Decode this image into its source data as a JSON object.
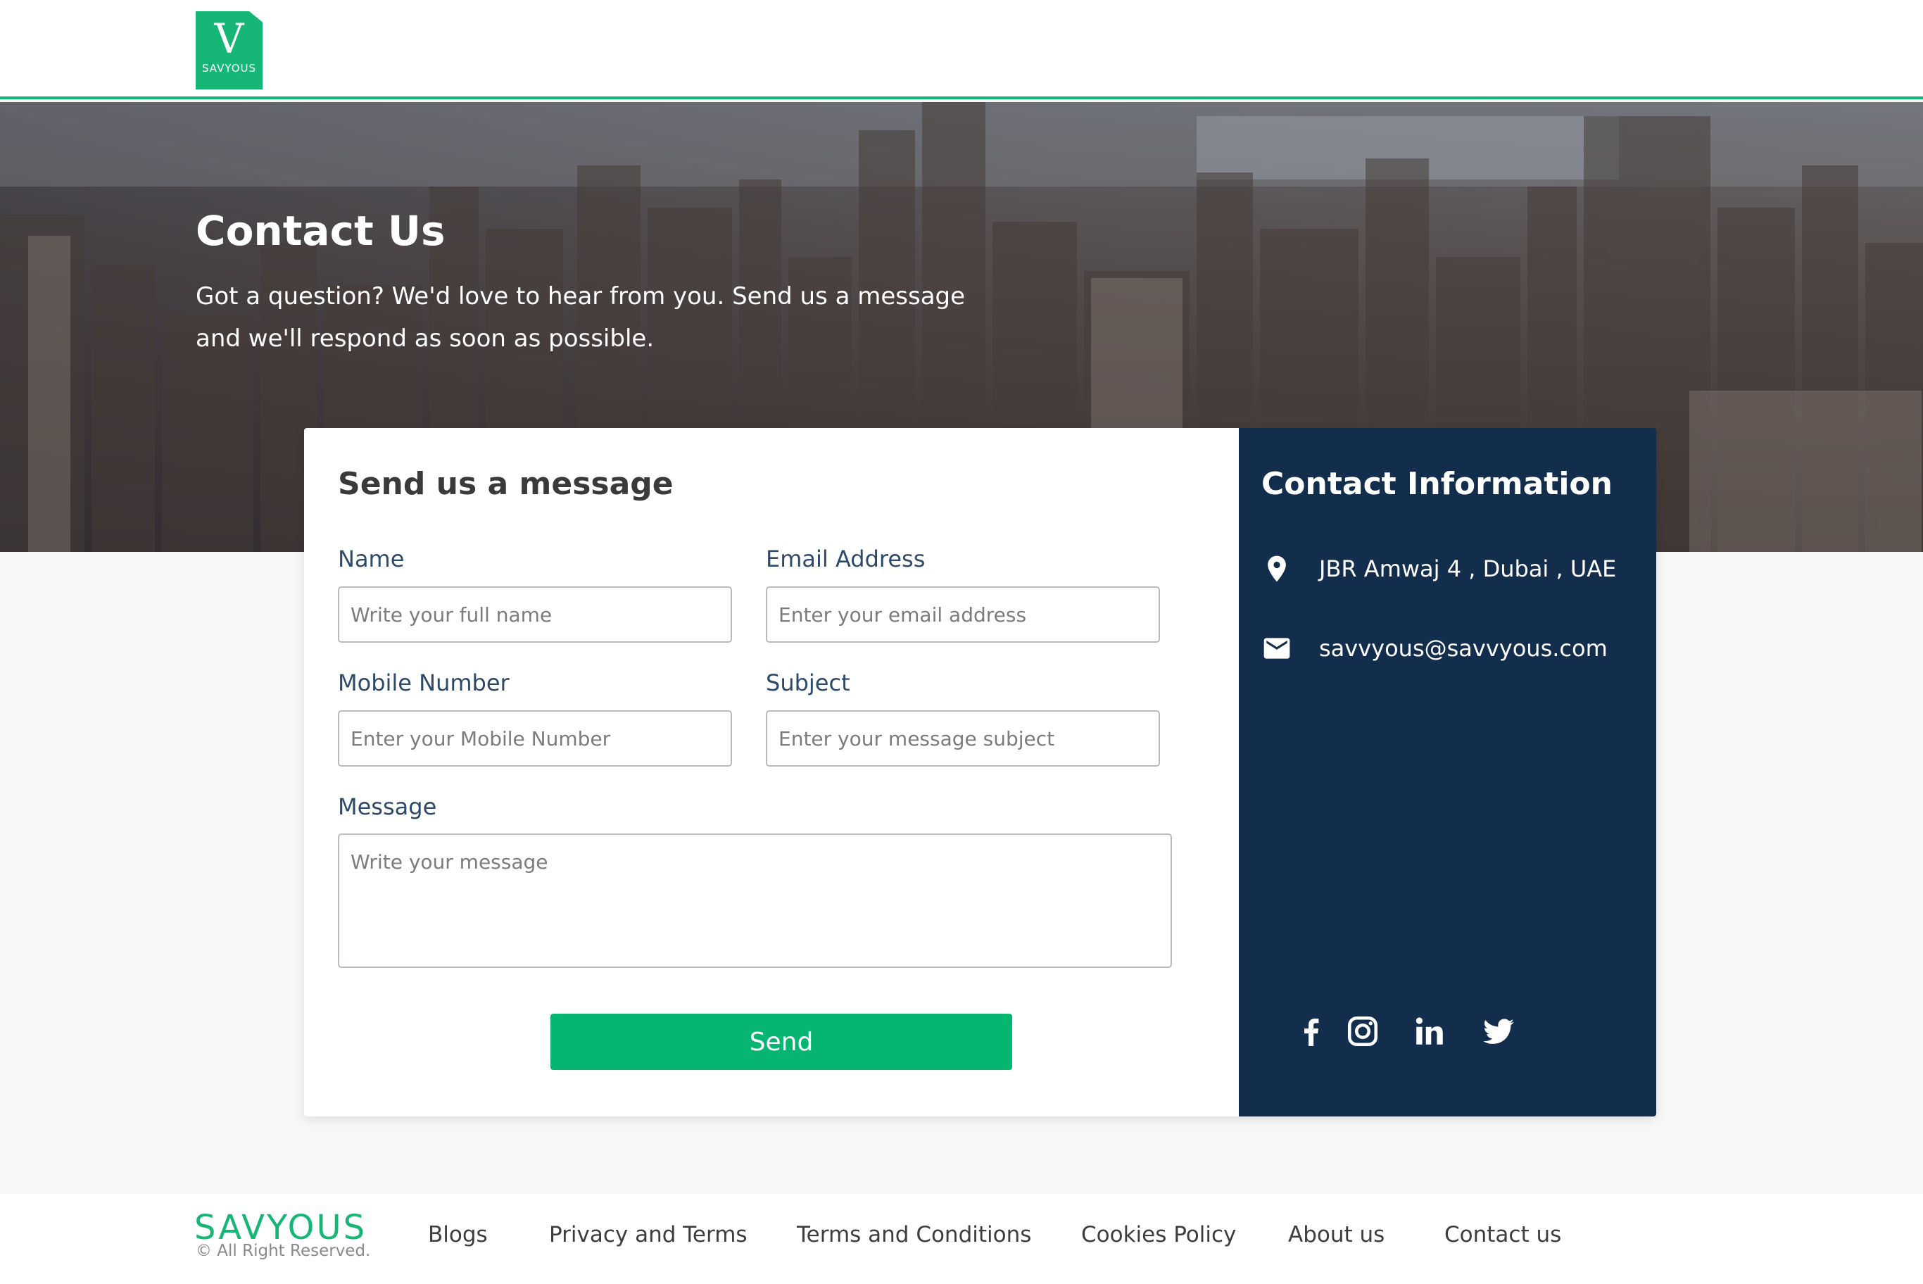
{
  "header": {
    "logo": {
      "mark": "V",
      "word": "SAVYOUS"
    }
  },
  "hero": {
    "title": "Contact Us",
    "subtitle": "Got a question? We'd love to hear from you. Send us a message and we'll respond as soon as possible."
  },
  "form": {
    "title": "Send us a message",
    "fields": {
      "name": {
        "label": "Name",
        "placeholder": "Write your full name",
        "value": ""
      },
      "email": {
        "label": "Email Address",
        "placeholder": "Enter your email address",
        "value": ""
      },
      "mobile": {
        "label": "Mobile Number",
        "placeholder": "Enter your Mobile Number",
        "value": ""
      },
      "subject": {
        "label": "Subject",
        "placeholder": "Enter your message subject",
        "value": ""
      },
      "message": {
        "label": "Message",
        "placeholder": "Write your message",
        "value": ""
      }
    },
    "send_label": "Send"
  },
  "contact_info": {
    "title": "Contact Information",
    "address": {
      "icon": "map-pin-icon",
      "text": "JBR Amwaj 4 , Dubai , UAE"
    },
    "email": {
      "icon": "mail-icon",
      "text": "savvyous@savvyous.com"
    },
    "social": [
      "facebook-icon",
      "instagram-icon",
      "linkedin-icon",
      "twitter-icon"
    ]
  },
  "footer": {
    "brand": "SAVYOUS",
    "copyright": "© All Right Reserved.",
    "links": [
      "Blogs",
      "Privacy and Terms",
      "Terms and Conditions",
      "Cookies Policy",
      "About us",
      "Contact us"
    ]
  },
  "colors": {
    "accent": "#06b570",
    "info_panel": "#132d4c",
    "label": "#2d4a6a"
  }
}
